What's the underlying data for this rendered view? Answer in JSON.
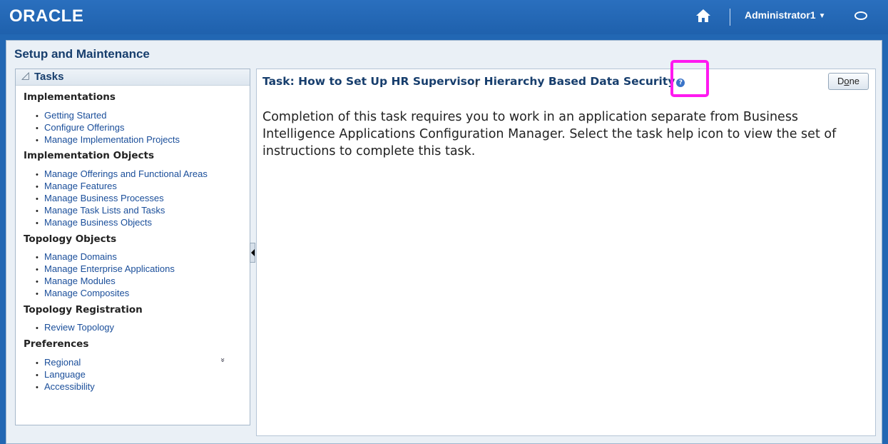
{
  "header": {
    "logo": "ORACLE",
    "user_name": "Administrator1",
    "user_caret": "▼"
  },
  "page": {
    "title": "Setup and Maintenance"
  },
  "tasks": {
    "label": "Tasks",
    "toggle_glyph": "◿",
    "more_glyph": "»",
    "groups": [
      {
        "heading": "Implementations",
        "items": [
          "Getting Started",
          "Configure Offerings",
          "Manage Implementation Projects"
        ]
      },
      {
        "heading": "Implementation Objects",
        "items": [
          "Manage Offerings and Functional Areas",
          "Manage Features",
          "Manage Business Processes",
          "Manage Task Lists and Tasks",
          "Manage Business Objects"
        ]
      },
      {
        "heading": "Topology Objects",
        "items": [
          "Manage Domains",
          "Manage Enterprise Applications",
          "Manage Modules",
          "Manage Composites"
        ]
      },
      {
        "heading": "Topology Registration",
        "items": [
          "Review Topology"
        ]
      },
      {
        "heading": "Preferences",
        "items": [
          "Regional",
          "Language",
          "Accessibility"
        ]
      }
    ]
  },
  "main": {
    "task_title": "Task: How to Set Up HR Supervisor Hierarchy Based Data Security",
    "help_glyph": "?",
    "done_prefix": "D",
    "done_underlined": "o",
    "done_suffix": "ne",
    "body": "Completion of this task requires you to work in an application separate from Business Intelligence Applications Configuration Manager. Select the task help icon to view the set of instructions to complete this task."
  },
  "colors": {
    "header_blue": "#2267b3",
    "link_blue": "#1a4e9a",
    "title_navy": "#173e6d",
    "highlight_magenta": "#ff19f0"
  }
}
